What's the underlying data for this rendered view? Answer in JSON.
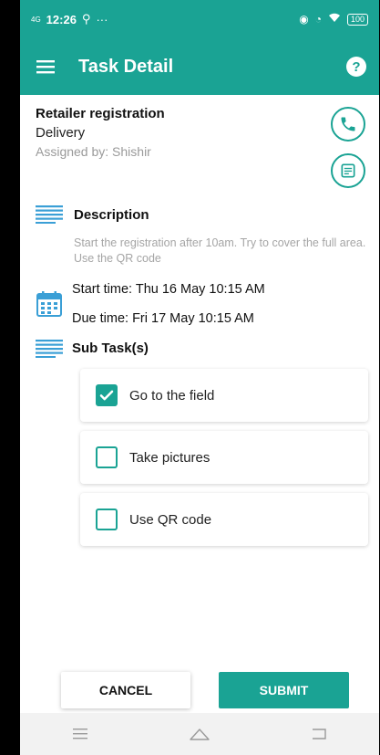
{
  "status_bar": {
    "time": "12:26",
    "signal_text": "4G",
    "battery": "100"
  },
  "app_bar": {
    "title": "Task Detail",
    "menu_icon": "hamburger-menu-icon",
    "help_icon": "help-icon",
    "help_glyph": "?"
  },
  "task": {
    "title": "Retailer registration",
    "type": "Delivery",
    "assigned_by": "Assigned by: Shishir"
  },
  "description": {
    "label": "Description",
    "text": "Start the registration after 10am. Try to cover the full area. Use the QR code"
  },
  "times": {
    "start": "Start time: Thu 16 May 10:15 AM",
    "due": "Due time: Fri 17 May 10:15 AM"
  },
  "subtasks": {
    "label": "Sub Task(s)",
    "items": [
      {
        "label": "Go to the field",
        "checked": true
      },
      {
        "label": "Take pictures",
        "checked": false
      },
      {
        "label": "Use QR code",
        "checked": false
      }
    ]
  },
  "actions": {
    "cancel": "CANCEL",
    "submit": "SUBMIT"
  },
  "colors": {
    "accent": "#1aa394"
  }
}
